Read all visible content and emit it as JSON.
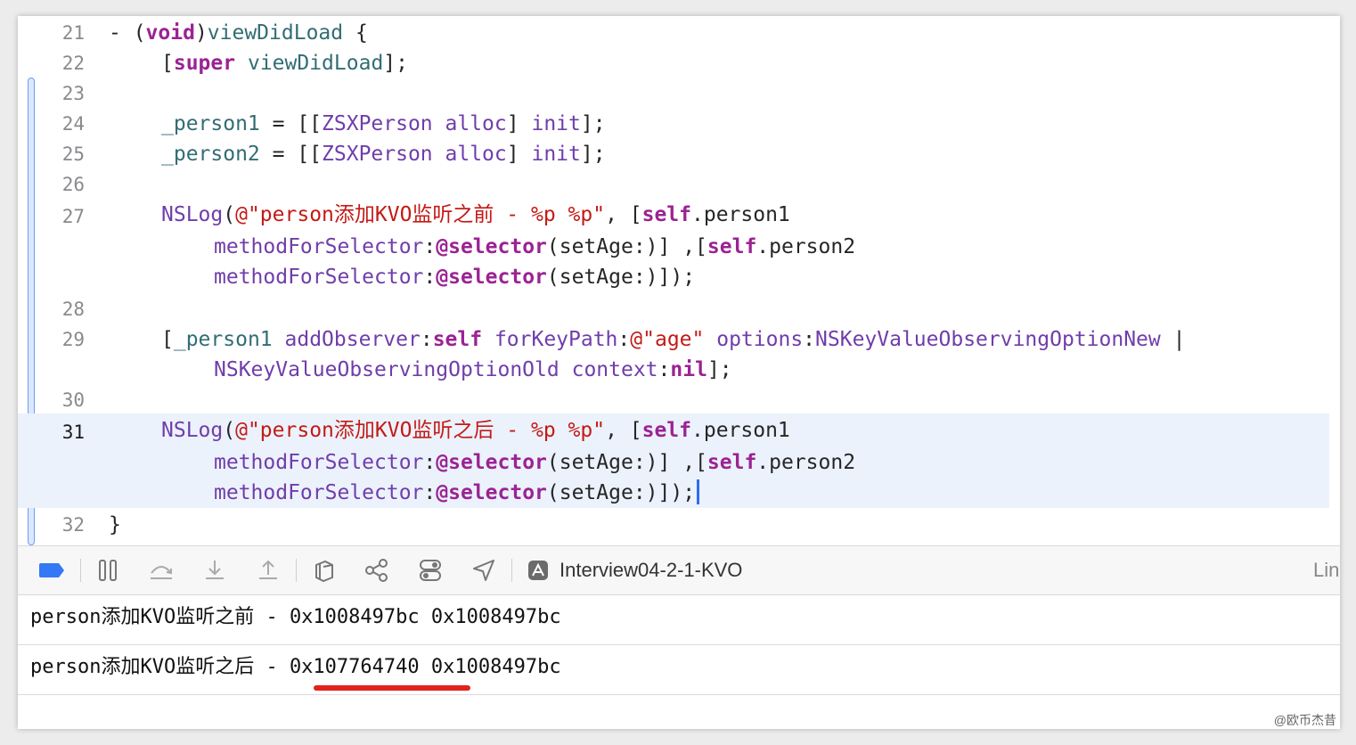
{
  "editor": {
    "line_numbers": [
      "21",
      "22",
      "23",
      "24",
      "25",
      "26",
      "27",
      "28",
      "29",
      "30",
      "31",
      "32"
    ],
    "current_line": "31",
    "lines": {
      "l21": [
        "- (",
        "void",
        ")",
        "viewDidLoad",
        " {"
      ],
      "l22": [
        "[",
        "super",
        " ",
        "viewDidLoad",
        "];"
      ],
      "l24": [
        "_person1",
        " = [[",
        "ZSXPerson",
        " ",
        "alloc",
        "] ",
        "init",
        "];"
      ],
      "l25": [
        "_person2",
        " = [[",
        "ZSXPerson",
        " ",
        "alloc",
        "] ",
        "init",
        "];"
      ],
      "l27a": [
        "NSLog",
        "(",
        "@\"person添加KVO监听之前 - %p %p\"",
        ", [",
        "self",
        ".person1"
      ],
      "l27b": [
        "methodForSelector",
        ":",
        "@selector",
        "(setAge:)] ,[",
        "self",
        ".person2"
      ],
      "l27c": [
        "methodForSelector",
        ":",
        "@selector",
        "(setAge:)]);"
      ],
      "l29a": [
        "[",
        "_person1",
        " ",
        "addObserver",
        ":",
        "self",
        " ",
        "forKeyPath",
        ":",
        "@\"age\"",
        " ",
        "options",
        ":",
        "NSKeyValueObservingOptionNew",
        " |"
      ],
      "l29b": [
        "NSKeyValueObservingOptionOld",
        " ",
        "context",
        ":",
        "nil",
        "];"
      ],
      "l31a": [
        "NSLog",
        "(",
        "@\"person添加KVO监听之后 - %p %p\"",
        ", [",
        "self",
        ".person1"
      ],
      "l31b": [
        "methodForSelector",
        ":",
        "@selector",
        "(setAge:)] ,[",
        "self",
        ".person2"
      ],
      "l31c": [
        "methodForSelector",
        ":",
        "@selector",
        "(setAge:)]);"
      ],
      "l32": [
        "}"
      ]
    }
  },
  "debug_bar": {
    "scheme": "Interview04-2-1-KVO",
    "right_label": "Lin",
    "icons": [
      "breakpoints-toggle-icon",
      "pause-icon",
      "step-over-icon",
      "step-into-icon",
      "step-out-icon",
      "view-hierarchy-icon",
      "memory-graph-icon",
      "environment-overrides-icon",
      "simulate-location-icon",
      "app-icon"
    ],
    "accent": "#3478f6"
  },
  "console": {
    "lines": [
      {
        "text": "person添加KVO监听之前 - 0x1008497bc 0x1008497bc"
      },
      {
        "text": "person添加KVO监听之后 - 0x107764740 0x1008497bc"
      }
    ],
    "highlight_color": "#e0231c"
  },
  "watermark": "@欧币杰昔"
}
